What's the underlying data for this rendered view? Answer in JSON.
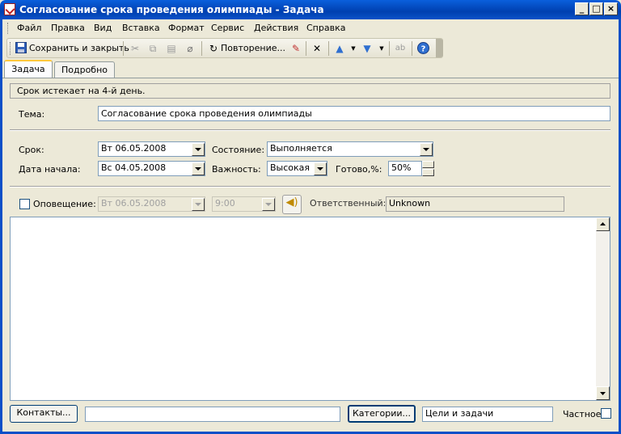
{
  "window": {
    "title": "Согласование срока проведения олимпиады - Задача"
  },
  "menu": [
    "Файл",
    "Правка",
    "Вид",
    "Вставка",
    "Формат",
    "Сервис",
    "Действия",
    "Справка"
  ],
  "toolbar": {
    "save_close": "Сохранить и закрыть",
    "recurrence": "Повторение..."
  },
  "tabs": [
    "Задача",
    "Подробно"
  ],
  "info": "Срок истекает на 4-й день.",
  "subject": {
    "label": "Тема:",
    "value": "Согласование срока проведения олимпиады"
  },
  "due": {
    "label": "Срок:",
    "value": "Вт 06.05.2008"
  },
  "start": {
    "label": "Дата начала:",
    "value": "Вс 04.05.2008"
  },
  "status": {
    "label": "Состояние:",
    "value": "Выполняется"
  },
  "priority": {
    "label": "Важность:",
    "value": "Высокая"
  },
  "complete": {
    "label": "Готово,%:",
    "value": "50%"
  },
  "reminder": {
    "label": "Оповещение:",
    "date": "Вт 06.05.2008",
    "time": "9:00"
  },
  "owner": {
    "label": "Ответственный:",
    "value": "Unknown"
  },
  "bottom": {
    "contacts_button": "Контакты...",
    "contacts_value": "",
    "categories_button": "Категории...",
    "categories_value": "Цели и задачи",
    "private_label": "Частное"
  },
  "colors": {
    "titlebar": "#0a5fdc",
    "face": "#ece9d8",
    "tab_highlight": "#ffc83c"
  }
}
